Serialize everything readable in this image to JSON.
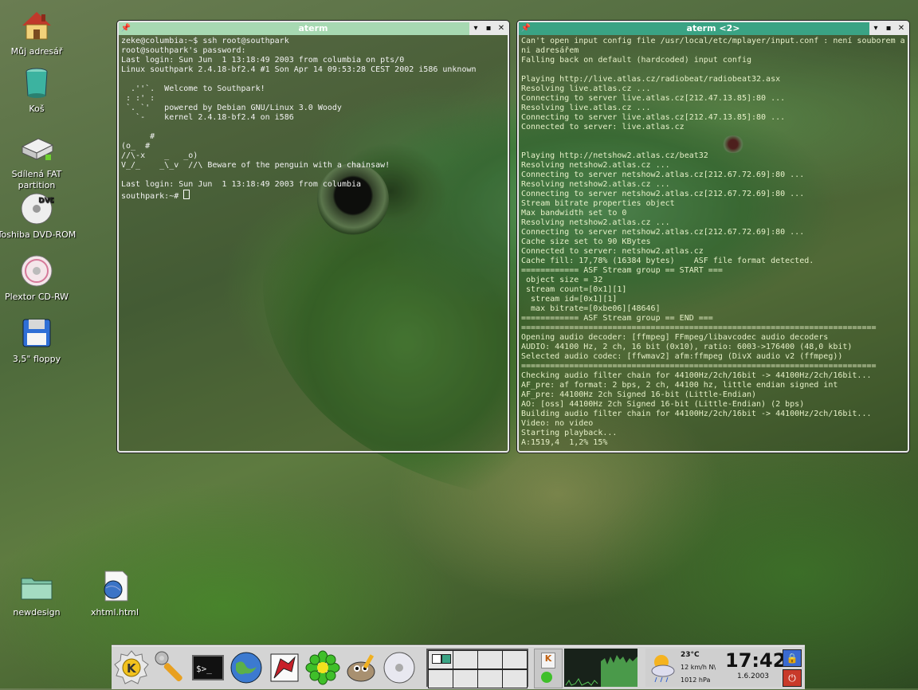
{
  "desktop": {
    "icons": [
      {
        "label": "Můj adresář",
        "icon": "home-icon"
      },
      {
        "label": "Koš",
        "icon": "trash-icon"
      },
      {
        "label": "Sdílená FAT partition",
        "icon": "drive-icon"
      },
      {
        "label": "Toshiba DVD-ROM",
        "icon": "dvd-icon"
      },
      {
        "label": "Plextor CD-RW",
        "icon": "cdrom-icon"
      },
      {
        "label": "3,5\" floppy",
        "icon": "floppy-icon"
      },
      {
        "label": "newdesign",
        "icon": "folder-icon"
      },
      {
        "label": "xhtml.html",
        "icon": "html-file-icon"
      }
    ]
  },
  "windows": {
    "left": {
      "title": "aterm",
      "title_color": "#a7d9b2",
      "lines": [
        "zeke@columbia:~$ ssh root@southpark",
        "root@southpark's password:",
        "Last login: Sun Jun  1 13:18:49 2003 from columbia on pts/0",
        "Linux southpark 2.4.18-bf2.4 #1 Son Apr 14 09:53:28 CEST 2002 i586 unknown",
        "",
        "  .''`.  Welcome to Southpark!",
        " : :' :",
        " `. `'   powered by Debian GNU/Linux 3.0 Woody",
        "   `-    kernel 2.4.18-bf2.4 on i586",
        "",
        "      #",
        "(o_  #",
        "//\\-x    _   _o)",
        "V_/_    _\\_v  //\\ Beware of the penguin with a chainsaw!",
        "",
        "Last login: Sun Jun  1 13:18:49 2003 from columbia",
        "southpark:~# "
      ]
    },
    "right": {
      "title": "aterm <2>",
      "title_color": "#3aa384",
      "lines": [
        "Can't open input config file /usr/local/etc/mplayer/input.conf : není souborem a",
        "ni adresářem",
        "Falling back on default (hardcoded) input config",
        "",
        "Playing http://live.atlas.cz/radiobeat/radiobeat32.asx",
        "Resolving live.atlas.cz ...",
        "Connecting to server live.atlas.cz[212.47.13.85]:80 ...",
        "Resolving live.atlas.cz ...",
        "Connecting to server live.atlas.cz[212.47.13.85]:80 ...",
        "Connected to server: live.atlas.cz",
        "",
        "",
        "Playing http://netshow2.atlas.cz/beat32",
        "Resolving netshow2.atlas.cz ...",
        "Connecting to server netshow2.atlas.cz[212.67.72.69]:80 ...",
        "Resolving netshow2.atlas.cz ...",
        "Connecting to server netshow2.atlas.cz[212.67.72.69]:80 ...",
        "Stream bitrate properties object",
        "Max bandwidth set to 0",
        "Resolving netshow2.atlas.cz ...",
        "Connecting to server netshow2.atlas.cz[212.67.72.69]:80 ...",
        "Cache size set to 90 KBytes",
        "Connected to server: netshow2.atlas.cz",
        "Cache fill: 17,78% (16384 bytes)    ASF file format detected.",
        "============ ASF Stream group == START ===",
        " object size = 32",
        " stream count=[0x1][1]",
        "  stream id=[0x1][1]",
        "  max bitrate=[0xbe06][48646]",
        "============ ASF Stream group == END ===",
        "==========================================================================",
        "Opening audio decoder: [ffmpeg] FFmpeg/libavcodec audio decoders",
        "AUDIO: 44100 Hz, 2 ch, 16 bit (0x10), ratio: 6003->176400 (48,0 kbit)",
        "Selected audio codec: [ffwmav2] afm:ffmpeg (DivX audio v2 (ffmpeg))",
        "==========================================================================",
        "Checking audio filter chain for 44100Hz/2ch/16bit -> 44100Hz/2ch/16bit...",
        "AF_pre: af format: 2 bps, 2 ch, 44100 hz, little endian signed int",
        "AF_pre: 44100Hz 2ch Signed 16-bit (Little-Endian)",
        "AO: [oss] 44100Hz 2ch Signed 16-bit (Little-Endian) (2 bps)",
        "Building audio filter chain for 44100Hz/2ch/16bit -> 44100Hz/2ch/16bit...",
        "Video: no video",
        "Starting playback...",
        "A:1519,4  1,2% 15%"
      ]
    }
  },
  "panel": {
    "launchers": [
      "k-menu-icon",
      "tools-icon",
      "terminal-icon",
      "browser-icon",
      "dragon-icon",
      "icq-icon",
      "gimp-icon",
      "cd-player-icon"
    ],
    "weather": {
      "temperature": "23°C",
      "wind": "12 km/h N\\",
      "pressure": "1012 hPa"
    },
    "clock": {
      "time": "17:42",
      "date": "1.6.2003"
    }
  }
}
